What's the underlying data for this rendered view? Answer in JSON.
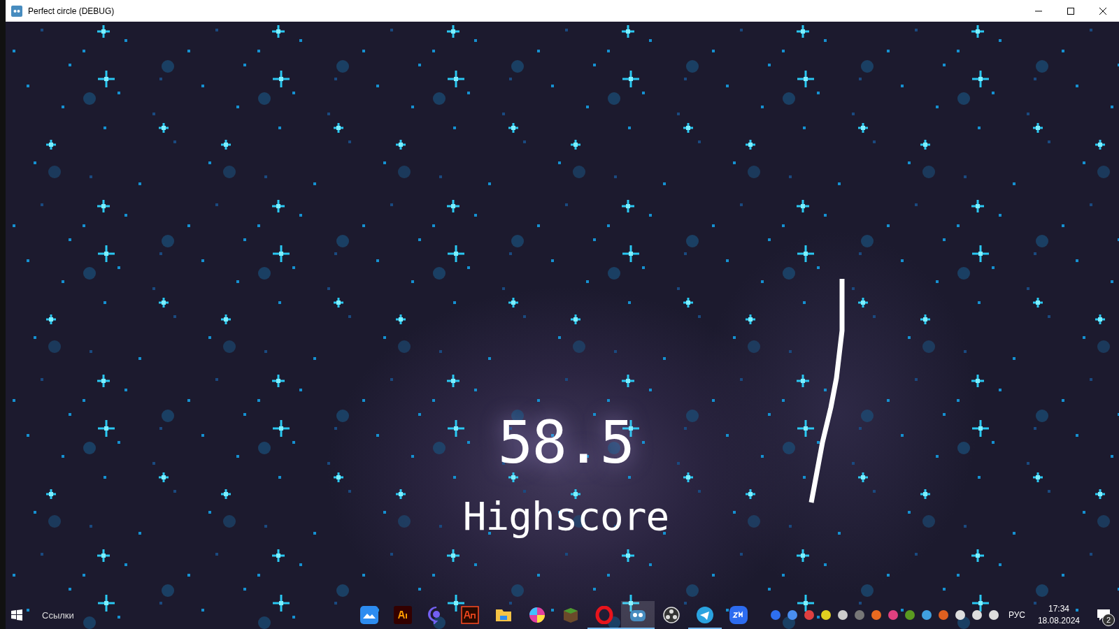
{
  "window": {
    "title": "Perfect circle (DEBUG)"
  },
  "game": {
    "score": "58.5",
    "label": "Highscore"
  },
  "taskbar": {
    "links_label": "Ссылки",
    "apps": [
      {
        "running": false,
        "selected": false
      },
      {
        "running": false,
        "selected": false
      },
      {
        "running": false,
        "selected": false
      },
      {
        "running": false,
        "selected": false
      },
      {
        "running": false,
        "selected": false
      },
      {
        "running": false,
        "selected": false
      },
      {
        "running": false,
        "selected": false
      },
      {
        "running": true,
        "selected": false
      },
      {
        "running": true,
        "selected": true
      },
      {
        "running": false,
        "selected": false
      },
      {
        "running": true,
        "selected": false
      },
      {
        "running": false,
        "selected": false
      }
    ],
    "language": "РУС",
    "time": "17:34",
    "date": "18.08.2024",
    "notifications": "2"
  }
}
